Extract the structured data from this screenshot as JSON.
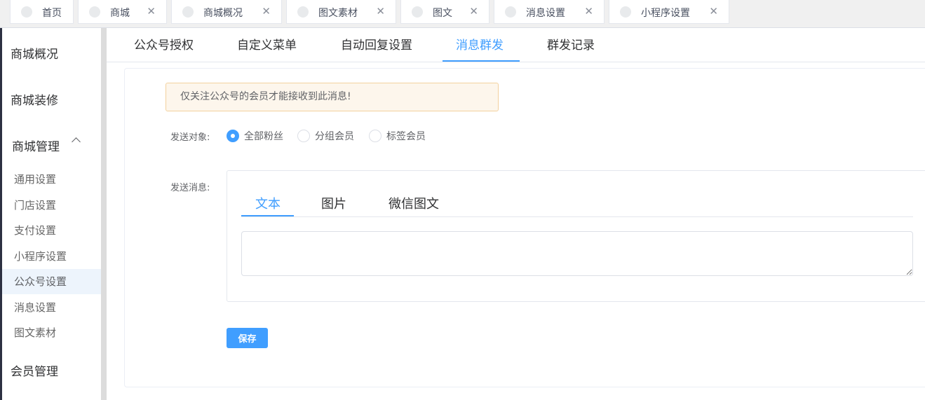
{
  "page_tabs": [
    {
      "label": "首页",
      "closable": false
    },
    {
      "label": "商城",
      "closable": true
    },
    {
      "label": "商城概况",
      "closable": true
    },
    {
      "label": "图文素材",
      "closable": true
    },
    {
      "label": "图文",
      "closable": true
    },
    {
      "label": "消息设置",
      "closable": true
    },
    {
      "label": "小程序设置",
      "closable": true
    }
  ],
  "sidebar": {
    "groups": [
      {
        "label": "商城概况"
      },
      {
        "label": "商城装修"
      },
      {
        "label": "商城管理"
      },
      {
        "label": "会员管理"
      }
    ],
    "items": [
      {
        "label": "通用设置"
      },
      {
        "label": "门店设置"
      },
      {
        "label": "支付设置"
      },
      {
        "label": "小程序设置"
      },
      {
        "label": "公众号设置",
        "active": true
      },
      {
        "label": "消息设置"
      },
      {
        "label": "图文素材"
      }
    ]
  },
  "sub_tabs": [
    {
      "label": "公众号授权"
    },
    {
      "label": "自定义菜单"
    },
    {
      "label": "自动回复设置"
    },
    {
      "label": "消息群发",
      "active": true
    },
    {
      "label": "群发记录"
    }
  ],
  "form": {
    "notice": "仅关注公众号的会员才能接收到此消息!",
    "target_label": "发送对象:",
    "target_options": [
      {
        "label": "全部粉丝",
        "checked": true
      },
      {
        "label": "分组会员",
        "checked": false
      },
      {
        "label": "标签会员",
        "checked": false
      }
    ],
    "message_label": "发送消息:",
    "message_tabs": [
      {
        "label": "文本",
        "active": true
      },
      {
        "label": "图片"
      },
      {
        "label": "微信图文"
      }
    ],
    "message_text": "",
    "save_label": "保存"
  },
  "colors": {
    "accent": "#409eff",
    "notice_bg": "#fdf6ec",
    "notice_border": "#f3d19e"
  }
}
